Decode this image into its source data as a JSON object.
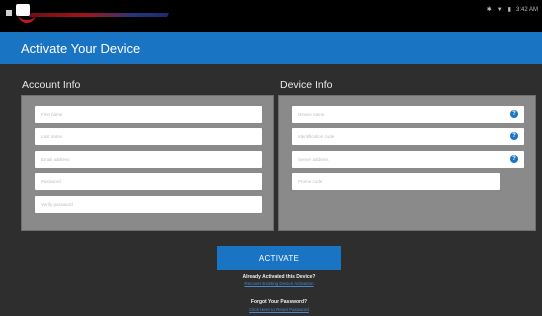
{
  "status_bar": {
    "time": "3:42 AM",
    "icons": [
      "notification-icon",
      "bluetooth-icon",
      "wifi-icon",
      "battery-icon"
    ]
  },
  "header": {
    "title": "Activate Your Device"
  },
  "account_info": {
    "label": "Account Info",
    "fields": [
      {
        "placeholder": "First name"
      },
      {
        "placeholder": "Last name"
      },
      {
        "placeholder": "Email address"
      },
      {
        "placeholder": "Password"
      },
      {
        "placeholder": "Verify password"
      }
    ]
  },
  "device_info": {
    "label": "Device Info",
    "fields": [
      {
        "placeholder": "Device name"
      },
      {
        "placeholder": "Identification code"
      },
      {
        "placeholder": "Server address"
      },
      {
        "placeholder": "Promo code"
      }
    ],
    "help_symbol": "?"
  },
  "actions": {
    "activate_label": "ACTIVATE",
    "already_activated_title": "Already Activated this Device?",
    "already_activated_link": "Recover Existing Device Activation",
    "forgot_title": "Forgot Your Password?",
    "forgot_link": "Click Here to Reset Password"
  },
  "colors": {
    "accent": "#1a74c4",
    "background": "#2e2e2e",
    "panel": "#8a8a8a",
    "logo_red": "#c0181e"
  }
}
